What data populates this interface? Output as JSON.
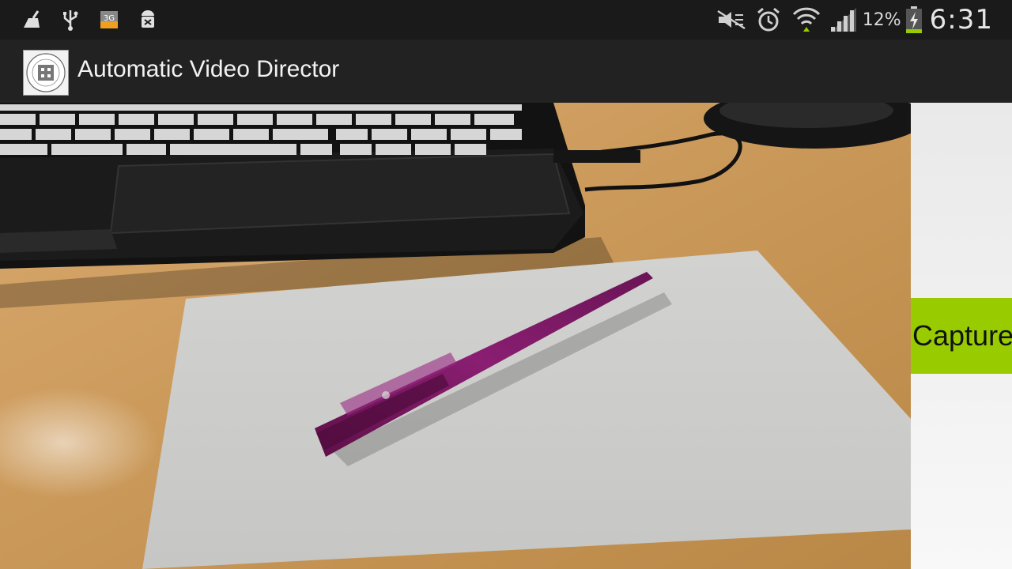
{
  "status_bar": {
    "left_icons": [
      "cleaner-icon",
      "usb-icon",
      "3g-data-icon",
      "android-debug-icon"
    ],
    "right_icons": [
      "mute-icon",
      "alarm-icon",
      "wifi-icon",
      "signal-icon",
      "battery-charging-icon"
    ],
    "battery_percent": "12%",
    "time": "6:31"
  },
  "action_bar": {
    "app_icon": "university-logo-icon",
    "title": "Automatic Video Director"
  },
  "preview": {
    "description_icon": "camera-preview"
  },
  "side_panel": {
    "capture_label": "Capture",
    "capture_color": "#99cc00"
  },
  "colors": {
    "status_bar_bg": "#1a1a1a",
    "action_bar_bg": "#222222",
    "accent_green": "#99cc00"
  }
}
